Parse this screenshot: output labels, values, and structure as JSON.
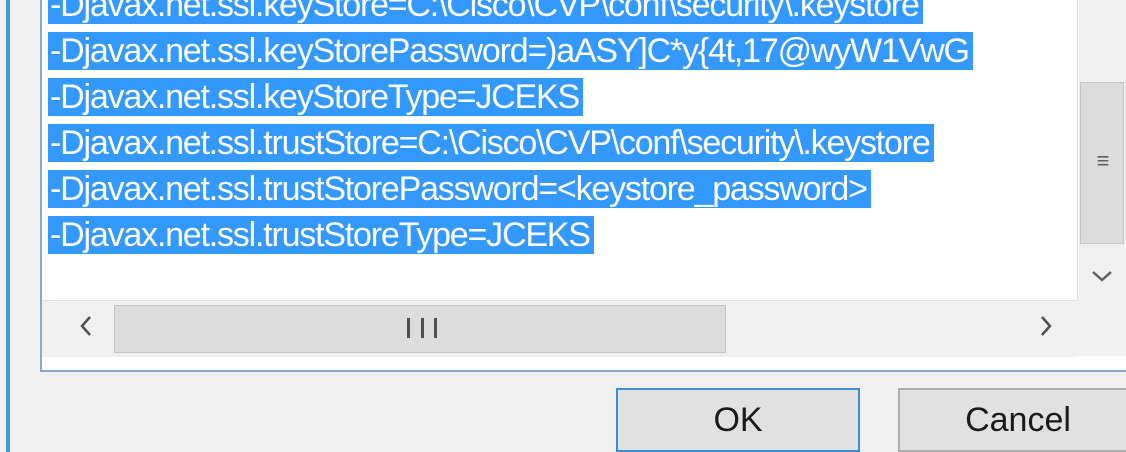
{
  "textbox": {
    "lines": [
      "-Djavax.net.ssl.keyStore=C:\\Cisco\\CVP\\conf\\security\\.keystore",
      "-Djavax.net.ssl.keyStorePassword=)aASY]C*y{4t,17@wyW1VwG",
      "-Djavax.net.ssl.keyStoreType=JCEKS",
      "-Djavax.net.ssl.trustStore=C:\\Cisco\\CVP\\conf\\security\\.keystore",
      "-Djavax.net.ssl.trustStorePassword=<keystore_password>",
      "-Djavax.net.ssl.trustStoreType=JCEKS"
    ],
    "selection_color": "#3399ff"
  },
  "buttons": {
    "ok_label": "OK",
    "cancel_label": "Cancel"
  },
  "icons": {
    "scroll_left": "chevron-left-icon",
    "scroll_right": "chevron-right-icon",
    "scroll_down": "chevron-down-icon",
    "h_grip": "grip-vertical-lines-icon",
    "v_grip": "grip-horizontal-lines-icon"
  },
  "colors": {
    "accent": "#3c9ddb",
    "selection": "#3399ff"
  }
}
